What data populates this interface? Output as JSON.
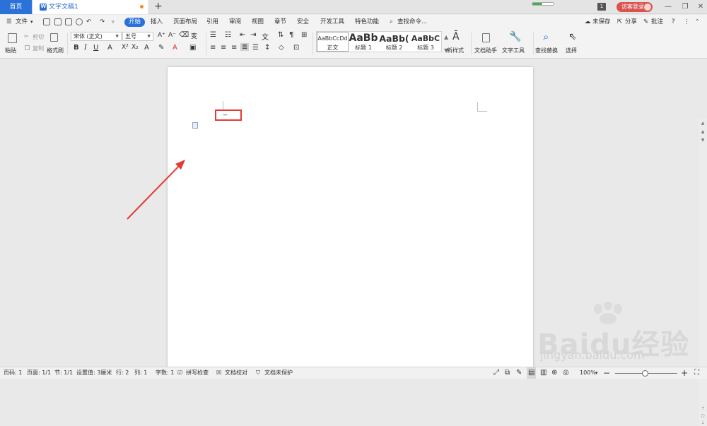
{
  "tabs": {
    "home": "首页",
    "document": "文字文稿1",
    "new_tab": "+"
  },
  "titlebar": {
    "badge": "1",
    "login": "访客登录",
    "progress": 0.45
  },
  "menu": {
    "file": "文件",
    "items": [
      "开始",
      "插入",
      "页面布局",
      "引用",
      "审阅",
      "视图",
      "章节",
      "安全",
      "开发工具",
      "特色功能"
    ],
    "search": "查找命令...",
    "unsaved": "未保存",
    "share": "分享",
    "comment": "批注"
  },
  "ribbon": {
    "paste": "粘贴",
    "cut": "剪切",
    "copy": "复制",
    "format_painter": "格式刷",
    "font_name": "宋体 (正文)",
    "font_size": "五号",
    "styles": [
      {
        "preview": "AaBbCcDd",
        "label": "正文"
      },
      {
        "preview": "AaBb",
        "label": "标题 1"
      },
      {
        "preview": "AaBb(",
        "label": "标题 2"
      },
      {
        "preview": "AaBbC",
        "label": "标题 3"
      }
    ],
    "new_style": "新样式",
    "doc_helper": "文档助手",
    "text_tools": "文字工具",
    "find_replace": "查找替换",
    "select": "选择"
  },
  "document": {
    "cursor_text": "---"
  },
  "watermark": {
    "logo": "Baidu经验",
    "url": "jingyan.baidu.com"
  },
  "status": {
    "page_num": "页码: 1",
    "pages": "页面: 1/1",
    "section": "节: 1/1",
    "setting": "设置值: 3厘米",
    "row": "行: 2",
    "col": "列: 1",
    "words": "字数: 1",
    "spell": "拼写检查",
    "proof": "文档校对",
    "protect": "文档未保护",
    "zoom": "100%"
  },
  "colors": {
    "accent": "#2a72d8",
    "highlight_box": "#e53935",
    "arrow": "#e53935"
  }
}
